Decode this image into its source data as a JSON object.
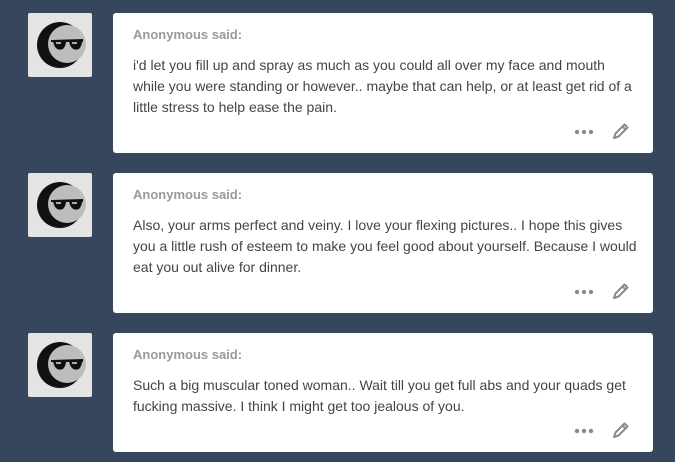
{
  "posts": [
    {
      "asker": "Anonymous said:",
      "body": "i'd let you fill up and spray as much as you could all over my face and mouth while you were standing or however.. maybe that can help, or at least get rid of a little stress to help ease the pain.",
      "avatar_icon": "sunglasses-moon-icon",
      "actions": [
        "more-icon",
        "edit-pencil-icon"
      ]
    },
    {
      "asker": "Anonymous said:",
      "body": "Also, your arms perfect and veiny. I love your flexing pictures.. I hope this gives you a little rush of esteem to make you feel good about yourself. Because I would eat you out alive for dinner.",
      "avatar_icon": "sunglasses-moon-icon",
      "actions": [
        "more-icon",
        "edit-pencil-icon"
      ]
    },
    {
      "asker": "Anonymous said:",
      "body": "Such a big muscular toned woman.. Wait till you get full abs and your quads get fucking massive. I think I might get too jealous of you.",
      "avatar_icon": "sunglasses-moon-icon",
      "actions": [
        "more-icon",
        "edit-pencil-icon"
      ]
    }
  ],
  "colors": {
    "background": "#36465d",
    "card": "#ffffff",
    "asker_text": "#9a9a9a",
    "body_text": "#444444",
    "icon": "#8a8a8a"
  }
}
